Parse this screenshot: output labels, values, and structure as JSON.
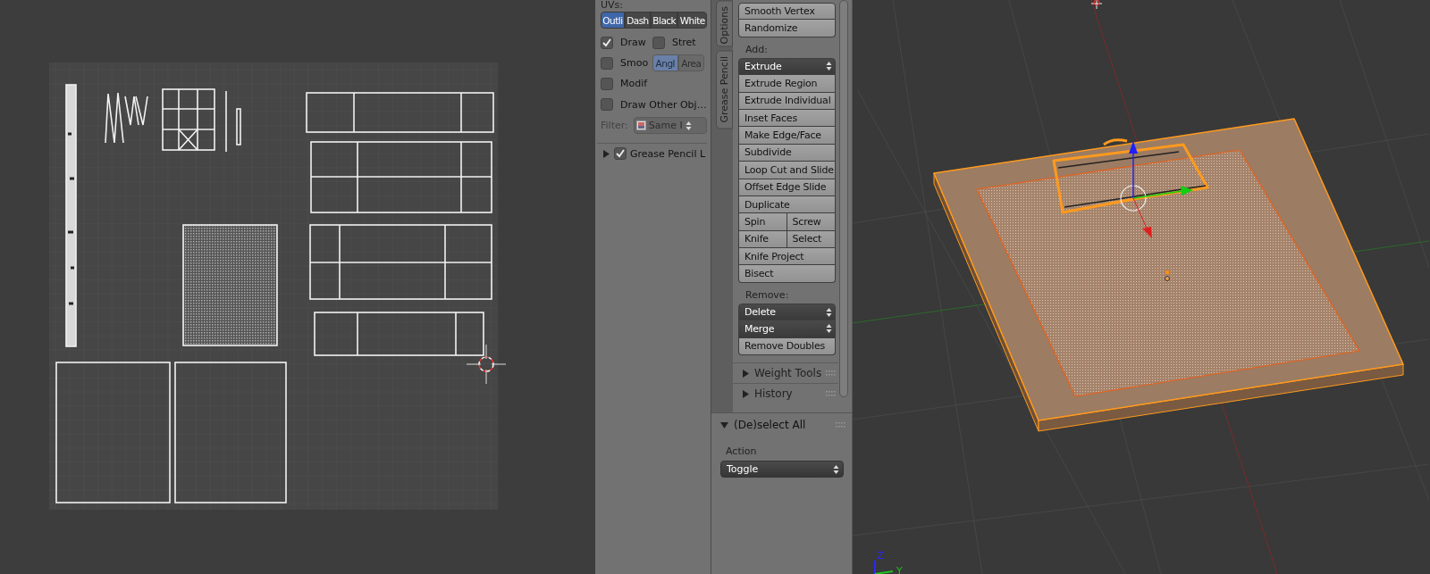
{
  "uv_display_panel": {
    "heading": "UVs:",
    "edge_modes": [
      {
        "label": "Outli",
        "selected": true
      },
      {
        "label": "Dash",
        "selected": false
      },
      {
        "label": "Black",
        "selected": false
      },
      {
        "label": "White",
        "selected": false
      }
    ],
    "options": [
      {
        "label": "Draw",
        "checked": true
      },
      {
        "label": "Stret",
        "checked": false
      },
      {
        "label": "Smoo",
        "checked": false
      },
      {
        "label": "Modif",
        "checked": false
      }
    ],
    "stretch_modes": [
      {
        "label": "Angl",
        "selected": true
      },
      {
        "label": "Area",
        "selected": false
      }
    ],
    "draw_other_objects": {
      "label": "Draw Other Obj…",
      "checked": false
    },
    "filter": {
      "label": "Filter:",
      "value": "Same I",
      "disabled": true
    },
    "grease_pencil_layer": {
      "label": "Grease Pencil L",
      "checked": true,
      "expanded": false
    }
  },
  "tabs": [
    {
      "label": "Options"
    },
    {
      "label": "Grease Pencil"
    }
  ],
  "tool_shelf": {
    "groups": [
      {
        "items": [
          {
            "kind": "button",
            "label": "Smooth Vertex"
          },
          {
            "kind": "button",
            "label": "Randomize"
          }
        ]
      },
      {
        "heading": "Add:",
        "items": [
          {
            "kind": "dropdown",
            "label": "Extrude"
          },
          {
            "kind": "button",
            "label": "Extrude Region"
          },
          {
            "kind": "button",
            "label": "Extrude Individual"
          },
          {
            "kind": "button",
            "label": "Inset Faces"
          },
          {
            "kind": "button",
            "label": "Make Edge/Face"
          },
          {
            "kind": "button",
            "label": "Subdivide"
          },
          {
            "kind": "button",
            "label": "Loop Cut and Slide"
          },
          {
            "kind": "button",
            "label": "Offset Edge Slide"
          },
          {
            "kind": "button",
            "label": "Duplicate"
          },
          {
            "kind": "pair",
            "labels": [
              "Spin",
              "Screw"
            ]
          },
          {
            "kind": "pair",
            "labels": [
              "Knife",
              "Select"
            ]
          },
          {
            "kind": "button",
            "label": "Knife Project"
          },
          {
            "kind": "button",
            "label": "Bisect"
          }
        ]
      },
      {
        "heading": "Remove:",
        "items": [
          {
            "kind": "dropdown",
            "label": "Delete"
          },
          {
            "kind": "dropdown",
            "label": "Merge"
          },
          {
            "kind": "button",
            "label": "Remove Doubles"
          }
        ]
      }
    ],
    "panels": [
      {
        "label": "Weight Tools",
        "expanded": false
      },
      {
        "label": "History",
        "expanded": false
      }
    ]
  },
  "operator_panel": {
    "title": "(De)select All",
    "expanded": true,
    "field_label": "Action",
    "value": "Toggle"
  },
  "viewport": {
    "axis_labels": [
      {
        "label": "Z",
        "color": "#2828ff"
      },
      {
        "label": "Y",
        "color": "#20c020"
      }
    ]
  }
}
